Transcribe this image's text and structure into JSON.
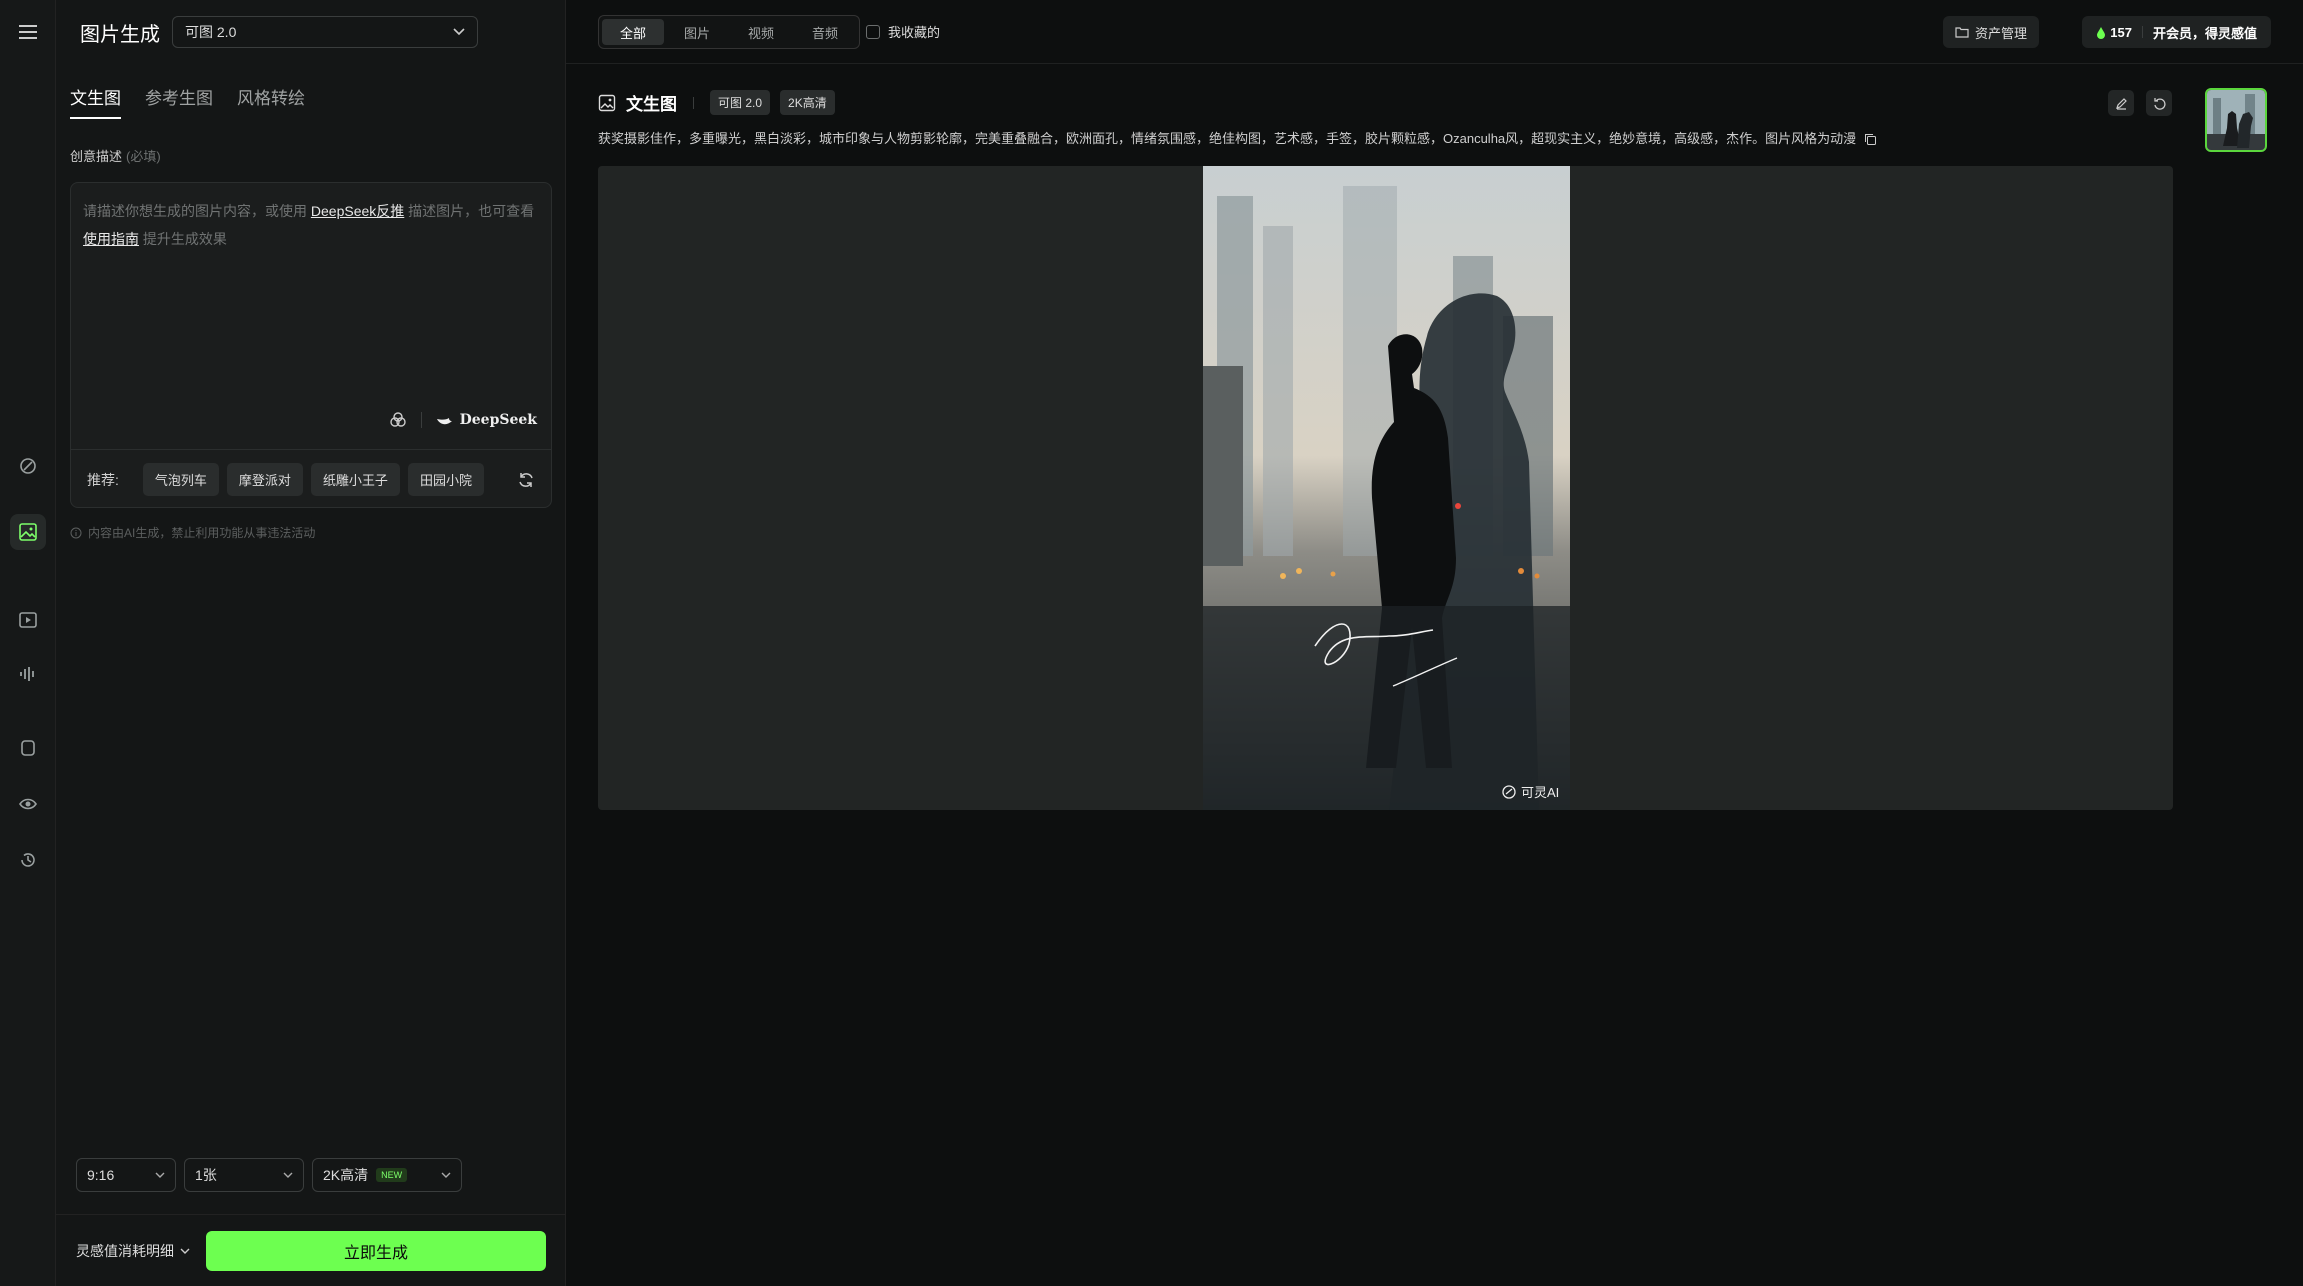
{
  "rail": {
    "items": [
      {
        "name": "rail-item-skills",
        "icon": "sparkle-pen-icon"
      },
      {
        "name": "rail-item-image",
        "icon": "image-icon",
        "active": true
      },
      {
        "name": "rail-item-video",
        "icon": "video-icon"
      },
      {
        "name": "rail-item-audio",
        "icon": "waveform-icon"
      },
      {
        "name": "rail-item-model",
        "icon": "cube-icon"
      },
      {
        "name": "rail-item-preview",
        "icon": "eye-icon"
      },
      {
        "name": "rail-item-history",
        "icon": "history-icon"
      }
    ]
  },
  "panel": {
    "title": "图片生成",
    "model": "可图 2.0",
    "tabs": [
      "文生图",
      "参考生图",
      "风格转绘"
    ],
    "desc_label": "创意描述",
    "desc_required": "(必填)",
    "placeholder_pre": "请描述你想生成的图片内容，或使用",
    "placeholder_link1": "DeepSeek反推",
    "placeholder_mid": "描述图片，也可查看",
    "placeholder_link2": "使用指南",
    "placeholder_post": "提升生成效果",
    "deepseek": "DeepSeek",
    "rec_label": "推荐:",
    "chips": [
      "气泡列车",
      "摩登派对",
      "纸雕小王子",
      "田园小院"
    ],
    "disclaimer": "内容由AI生成，禁止利用功能从事违法活动",
    "ratio": "9:16",
    "count": "1张",
    "quality": "2K高清",
    "quality_badge": "NEW",
    "cost_detail": "灵感值消耗明细",
    "generate": "立即生成"
  },
  "topbar": {
    "filters": [
      "全部",
      "图片",
      "视频",
      "音频"
    ],
    "active_filter": 0,
    "favorite": "我收藏的",
    "assets": "资产管理",
    "credits": "157",
    "vip": "开会员，得灵感值"
  },
  "result": {
    "title": "文生图",
    "model_tag": "可图 2.0",
    "quality_tag": "2K高清",
    "prompt": "获奖摄影佳作，多重曝光，黑白淡彩，城市印象与人物剪影轮廓，完美重叠融合，欧洲面孔，情绪氛围感，绝佳构图，艺术感，手签，胶片颗粒感，Ozanculha风，超现实主义，绝妙意境，高级感，杰作。图片风格为动漫",
    "watermark": "可灵AI"
  },
  "colors": {
    "accent": "#6dff50",
    "bg": "#0d0f0f",
    "panel": "#141616"
  }
}
